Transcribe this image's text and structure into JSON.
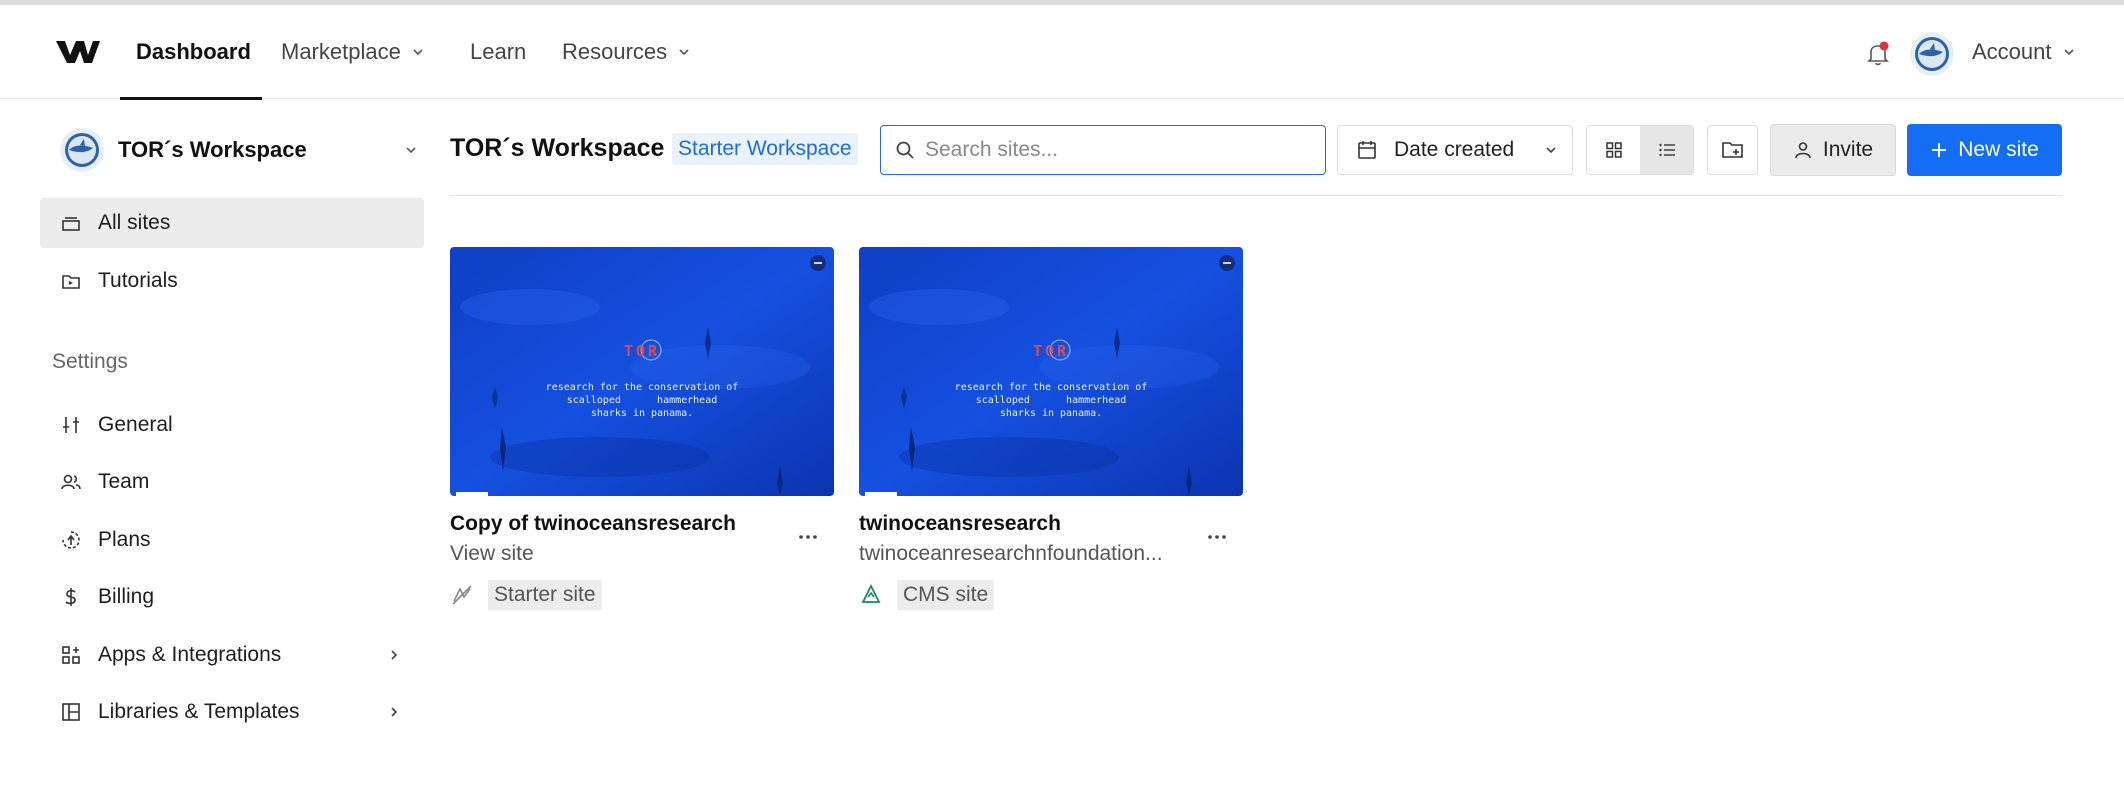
{
  "nav": {
    "logo_icon": "webflow-logo",
    "items": [
      {
        "label": "Dashboard",
        "active": true
      },
      {
        "label": "Marketplace",
        "dropdown": true
      },
      {
        "label": "Learn"
      },
      {
        "label": "Resources",
        "dropdown": true
      }
    ],
    "notifications_icon": "bell-icon",
    "notification_dot_color": "#e0323e",
    "account_label": "Account"
  },
  "sidebar": {
    "workspace_name": "TOR´s Workspace",
    "items": [
      {
        "label": "All sites",
        "icon": "stack-icon",
        "active": true
      },
      {
        "label": "Tutorials",
        "icon": "video-folder-icon"
      }
    ],
    "settings_heading": "Settings",
    "settings_items": [
      {
        "label": "General",
        "icon": "sliders-icon"
      },
      {
        "label": "Team",
        "icon": "team-icon"
      },
      {
        "label": "Plans",
        "icon": "plans-icon"
      },
      {
        "label": "Billing",
        "icon": "dollar-icon"
      },
      {
        "label": "Apps & Integrations",
        "icon": "apps-icon",
        "expandable": true
      },
      {
        "label": "Libraries & Templates",
        "icon": "library-icon",
        "expandable": true
      }
    ]
  },
  "toolbar": {
    "title": "TOR´s Workspace",
    "plan_badge": "Starter Workspace",
    "search_placeholder": "Search sites...",
    "search_value": "",
    "sort_label": "Date created",
    "invite_label": "Invite",
    "new_site_label": "New site",
    "accent_color": "#146ef5"
  },
  "sites": [
    {
      "title": "Copy of twinoceansresearch",
      "subtitle": "View site",
      "tag": "Starter site",
      "tag_icon": "no-publish-icon",
      "thumb_brand": "TOR",
      "thumb_tagline": "research for the conservation of\nscalloped      hammerhead\nsharks in panama."
    },
    {
      "title": "twinoceansresearch",
      "subtitle": "twinoceanresearchnfoundation...",
      "tag": "CMS site",
      "tag_icon": "cms-icon",
      "thumb_brand": "TOR",
      "thumb_tagline": "research for the conservation of\nscalloped      hammerhead\nsharks in panama."
    }
  ]
}
